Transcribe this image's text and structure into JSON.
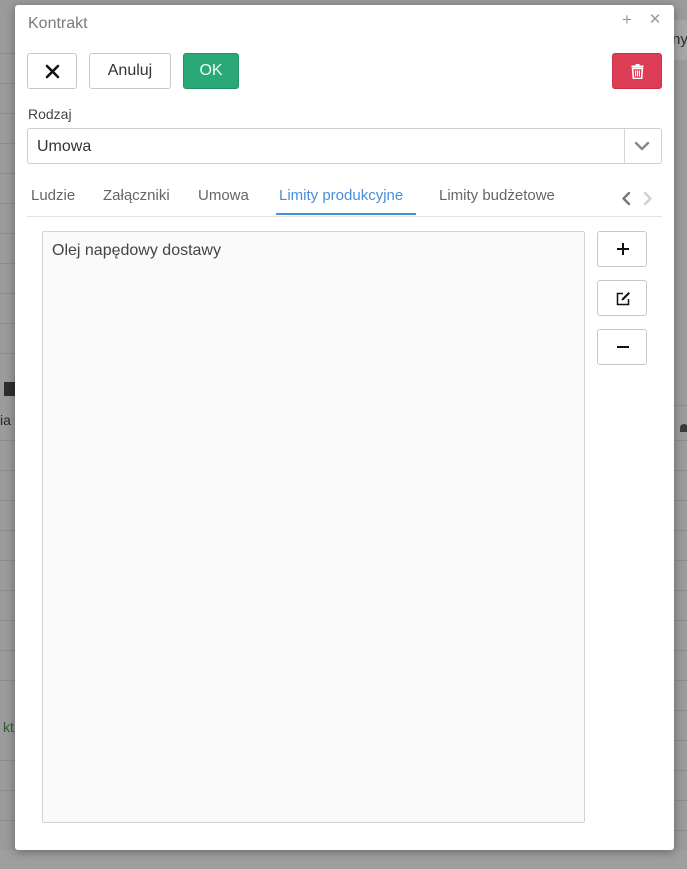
{
  "background": {
    "right_fragment": "ny",
    "left_fragment": "ia",
    "left_green_fragment": "kt"
  },
  "modal": {
    "title": "Kontrakt"
  },
  "toolbar": {
    "cancel_label": "Anuluj",
    "ok_label": "OK"
  },
  "form": {
    "type_label": "Rodzaj",
    "type_value": "Umowa"
  },
  "tabs": [
    {
      "label": "Ludzie"
    },
    {
      "label": "Załączniki"
    },
    {
      "label": "Umowa"
    },
    {
      "label": "Limity produkcyjne",
      "active": true
    },
    {
      "label": "Limity budżetowe"
    }
  ],
  "list": {
    "items": [
      {
        "label": "Olej napędowy dostawy"
      }
    ]
  },
  "colors": {
    "ok_button": "#2aa876",
    "delete_button": "#dc3d55",
    "active_tab": "#4a8fd6"
  }
}
